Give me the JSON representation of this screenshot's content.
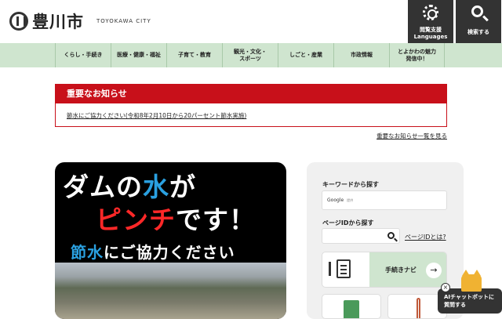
{
  "header": {
    "logo_jp": "豊川市",
    "logo_en": "TOYOKAWA CITY",
    "languages_line1": "閲覧支援",
    "languages_line2": "Languages",
    "search_label": "検索する"
  },
  "nav": {
    "items": [
      {
        "label": "くらし・手続き"
      },
      {
        "label": "医療・健康・福祉"
      },
      {
        "label": "子育て・教育"
      },
      {
        "label": "観光・文化・\nスポーツ"
      },
      {
        "label": "しごと・産業"
      },
      {
        "label": "市政情報"
      },
      {
        "label": "とよかわの魅力\n発信中！"
      }
    ]
  },
  "notice": {
    "title": "重要なお知らせ",
    "link": "節水にご協力ください(令和8年2月10日から20パーセント節水実施)",
    "more": "重要なお知らせ一覧を見る"
  },
  "banner": {
    "line1_a": "ダムの",
    "line1_b": "水",
    "line1_c": "が",
    "line2_a": "ピンチ",
    "line2_b": "です！",
    "line3_a": "節水",
    "line3_b": "にご協力ください"
  },
  "search": {
    "keyword_label": "キーワードから探す",
    "google_text": "Google",
    "google_sub": "提供",
    "page_id_label": "ページIDから探す",
    "page_id_help": "ページIDとは?",
    "navi_label": "手続きナビ",
    "navi_arrow": "→"
  },
  "chatbot": {
    "line1": "AIチャットボットに",
    "line2": "質問する",
    "close": "×"
  },
  "colors": {
    "nav_bg": "#cfe5cf",
    "notice_red": "#c8101a",
    "header_dark": "#333333"
  }
}
